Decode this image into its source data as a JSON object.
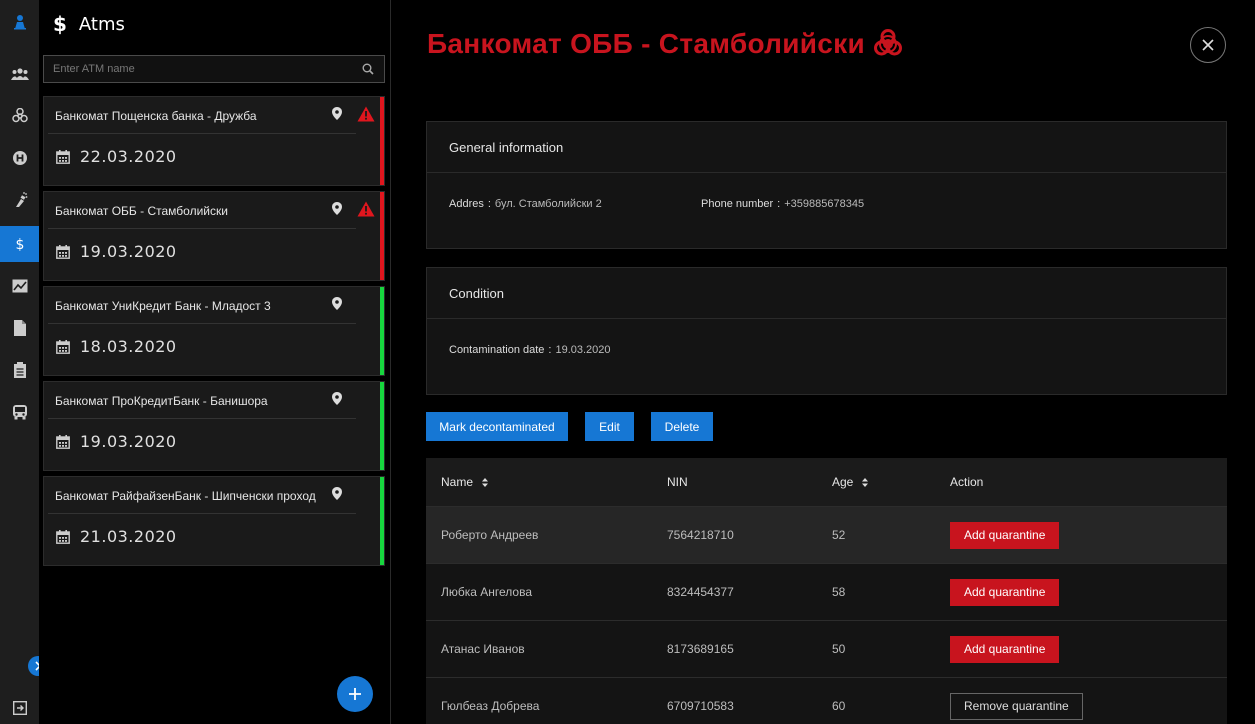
{
  "colors": {
    "accent": "#1677d4",
    "danger": "#c8141e",
    "ok": "#17d63e",
    "alert": "#e0161e"
  },
  "rail": {
    "items": [
      {
        "icon": "person-user-icon"
      },
      {
        "icon": "group-icon"
      },
      {
        "icon": "biohazard-icon"
      },
      {
        "icon": "hospital-icon"
      },
      {
        "icon": "spray-icon"
      },
      {
        "icon": "dollar-icon"
      },
      {
        "icon": "chart-icon"
      },
      {
        "icon": "document-icon"
      },
      {
        "icon": "clipboard-icon"
      },
      {
        "icon": "bus-icon"
      },
      {
        "icon": "logout-icon"
      }
    ]
  },
  "sidebar": {
    "title": "Atms",
    "search_placeholder": "Enter ATM name",
    "atms": [
      {
        "name": "Банкомат Пощенска банка - Дружба",
        "date": "22.03.2020",
        "contaminated": true
      },
      {
        "name": "Банкомат ОББ - Стамболийски",
        "date": "19.03.2020",
        "contaminated": true
      },
      {
        "name": "Банкомат УниКредит Банк - Младост 3",
        "date": "18.03.2020",
        "contaminated": false
      },
      {
        "name": "Банкомат ПроКредитБанк - Банишора",
        "date": "19.03.2020",
        "contaminated": false
      },
      {
        "name": "Банкомат РайфайзенБанк - Шипченски проход",
        "date": "21.03.2020",
        "contaminated": false
      }
    ]
  },
  "detail": {
    "title": "Банкомат ОББ - Стамболийски",
    "general": {
      "heading": "General information",
      "address_label": "Addres",
      "address_value": "бул. Стамболийски 2",
      "phone_label": "Phone number",
      "phone_value": "+359885678345"
    },
    "condition": {
      "heading": "Condition",
      "date_label": "Contamination date",
      "date_value": "19.03.2020"
    },
    "actions": {
      "decontaminate": "Mark decontaminated",
      "edit": "Edit",
      "delete": "Delete"
    },
    "table": {
      "headers": {
        "name": "Name",
        "nin": "NIN",
        "age": "Age",
        "action": "Action"
      },
      "rows": [
        {
          "name": "Роберто Андреев",
          "nin": "7564218710",
          "age": "52",
          "action": "Add quarantine"
        },
        {
          "name": "Любка Ангелова",
          "nin": "8324454377",
          "age": "58",
          "action": "Add quarantine"
        },
        {
          "name": "Атанас Иванов",
          "nin": "8173689165",
          "age": "50",
          "action": "Add quarantine"
        },
        {
          "name": "Гюлбеаз Добрева",
          "nin": "6709710583",
          "age": "60",
          "action": "Remove quarantine"
        }
      ]
    }
  }
}
